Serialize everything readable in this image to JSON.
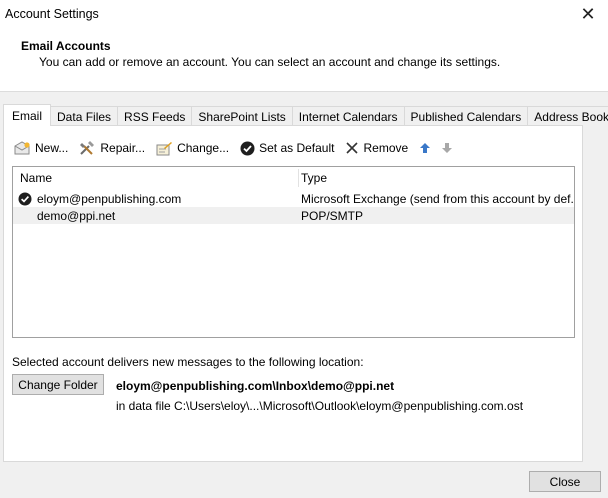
{
  "window": {
    "title": "Account Settings"
  },
  "header": {
    "title": "Email Accounts",
    "description": "You can add or remove an account. You can select an account and change its settings."
  },
  "tabs": [
    {
      "label": "Email"
    },
    {
      "label": "Data Files"
    },
    {
      "label": "RSS Feeds"
    },
    {
      "label": "SharePoint Lists"
    },
    {
      "label": "Internet Calendars"
    },
    {
      "label": "Published Calendars"
    },
    {
      "label": "Address Books"
    }
  ],
  "toolbar": {
    "new_label": "New...",
    "repair_label": "Repair...",
    "change_label": "Change...",
    "default_label": "Set as Default",
    "remove_label": "Remove"
  },
  "accounts": {
    "columns": {
      "name": "Name",
      "type": "Type"
    },
    "rows": [
      {
        "name": "eloym@penpublishing.com",
        "type": "Microsoft Exchange (send from this account by def...",
        "is_default": true
      },
      {
        "name": "demo@ppi.net",
        "type": "POP/SMTP",
        "is_default": false
      }
    ]
  },
  "delivery": {
    "description": "Selected account delivers new messages to the following location:",
    "change_folder_label": "Change Folder",
    "location": "eloym@penpublishing.com\\Inbox\\demo@ppi.net",
    "data_file": "in data file C:\\Users\\eloy\\...\\Microsoft\\Outlook\\eloym@penpublishing.com.ost"
  },
  "footer": {
    "close_label": "Close"
  }
}
